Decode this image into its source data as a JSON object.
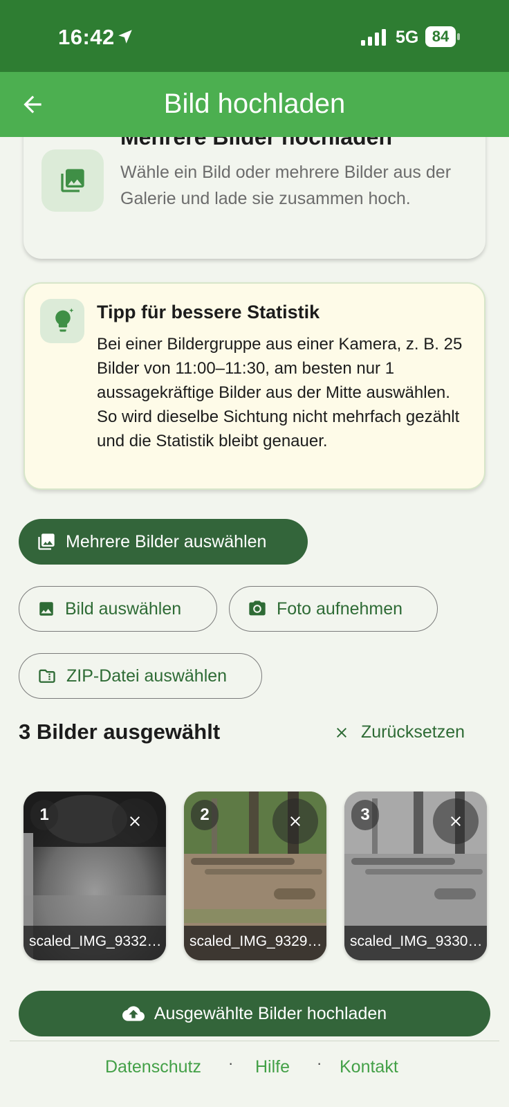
{
  "status_bar": {
    "time": "16:42",
    "network": "5G",
    "battery": "84"
  },
  "app_bar": {
    "title": "Bild hochladen"
  },
  "multi_card": {
    "title": "Mehrere Bilder hochladen",
    "description": "Wähle ein Bild oder mehrere Bilder aus der Galerie und lade sie zusammen hoch."
  },
  "tip": {
    "title": "Tipp für bessere Statistik",
    "body": "Bei einer Bildergruppe aus einer Kamera, z. B. 25 Bilder von 11:00–11:30, am besten nur 1 aussagekräftige Bilder aus der Mitte auswählen. So wird dieselbe Sichtung nicht mehrfach gezählt und die Statistik bleibt genauer."
  },
  "buttons": {
    "select_multiple": "Mehrere Bilder auswählen",
    "select_image": "Bild auswählen",
    "take_photo": "Foto aufnehmen",
    "select_zip": "ZIP-Datei auswählen",
    "upload_selected": "Ausgewählte Bilder hochladen"
  },
  "selection": {
    "count_label": "3 Bilder ausgewählt",
    "reset_label": "Zurücksetzen",
    "images": [
      {
        "number": "1",
        "filename": "scaled_IMG_9332…"
      },
      {
        "number": "2",
        "filename": "scaled_IMG_9329…"
      },
      {
        "number": "3",
        "filename": "scaled_IMG_9330…"
      }
    ]
  },
  "footer": {
    "links": [
      "Datenschutz",
      "Hilfe",
      "Kontakt"
    ],
    "separator": "·"
  }
}
